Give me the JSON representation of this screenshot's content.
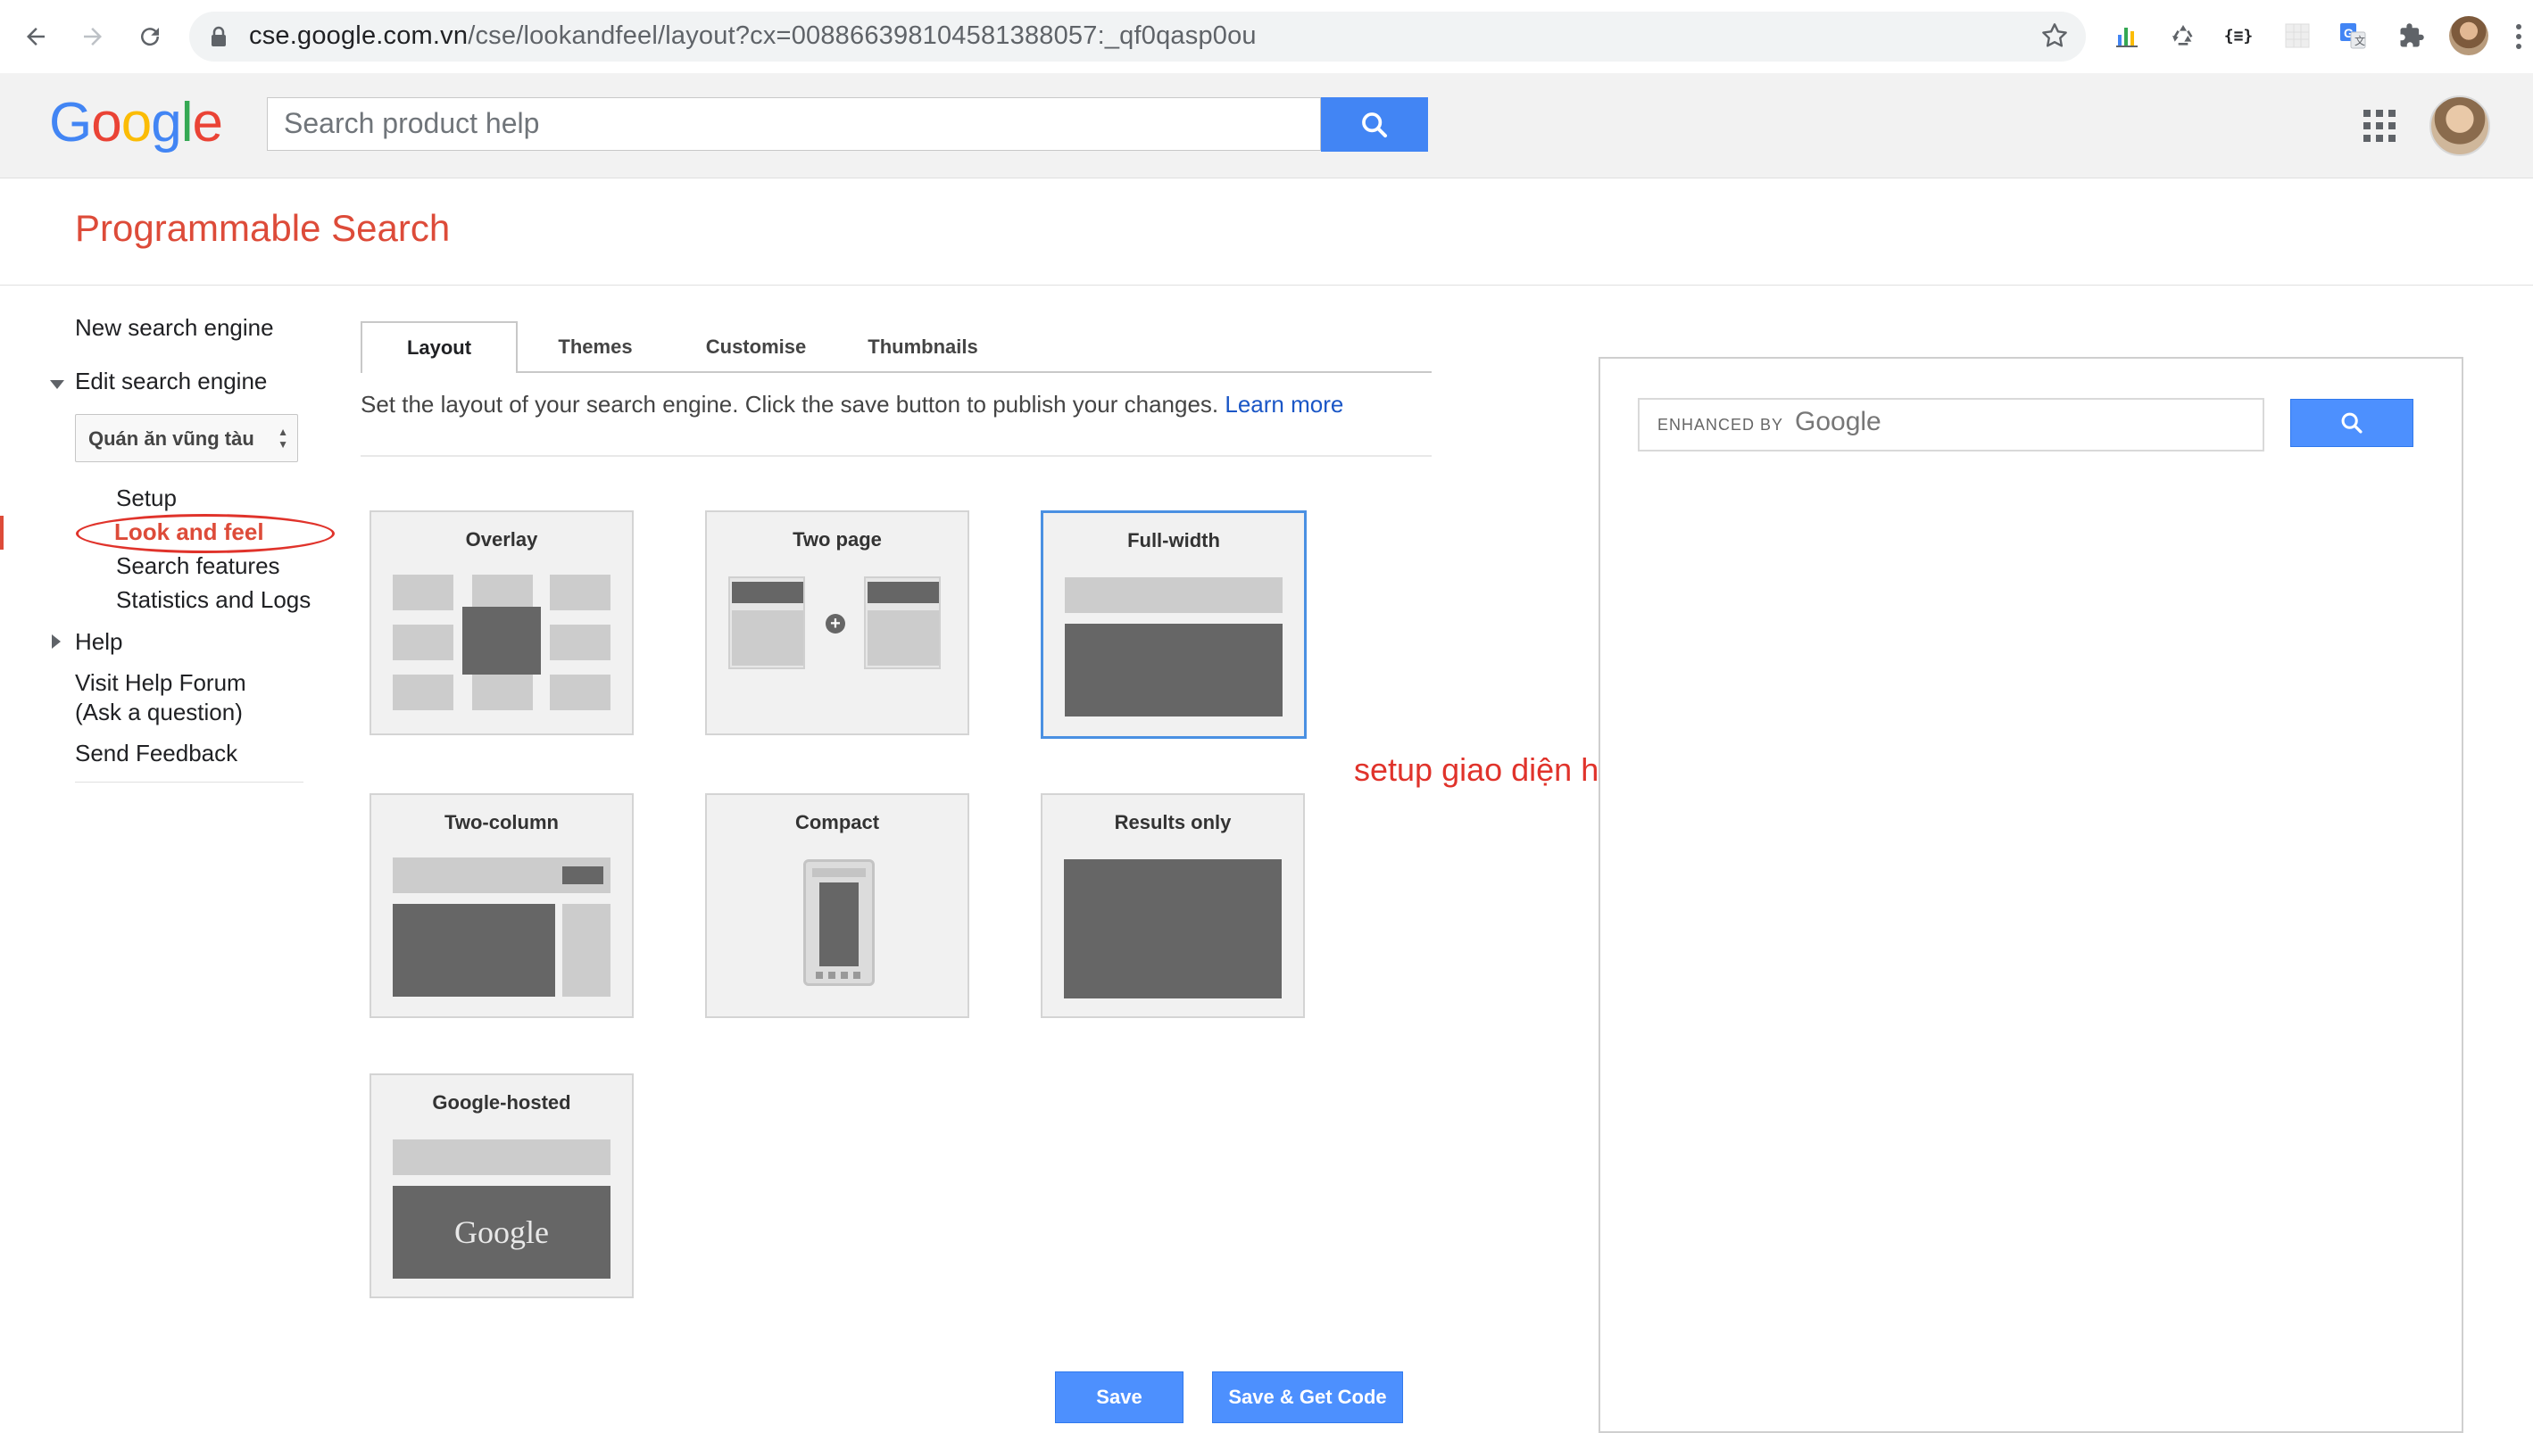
{
  "browser": {
    "url_host": "cse.google.com.vn",
    "url_path": "/cse/lookandfeel/layout?cx=008866398104581388057:_qf0qasp0ou",
    "extensions": [
      "bar-chart-icon",
      "recycle-icon",
      "braces-icon",
      "grid-square-icon",
      "translate-icon",
      "puzzle-icon"
    ]
  },
  "header": {
    "logo": [
      "G",
      "o",
      "o",
      "g",
      "l",
      "e"
    ],
    "logo_colors": [
      "#4285F4",
      "#EA4335",
      "#FBBC05",
      "#4285F4",
      "#34A853",
      "#EA4335"
    ],
    "search_placeholder": "Search product help"
  },
  "product_title": "Programmable Search",
  "sidebar": {
    "new_engine": "New search engine",
    "edit_engine": "Edit search engine",
    "engine_selected": "Quán ăn vũng tàu",
    "sub_items": [
      "Setup",
      "Look and feel",
      "Search features",
      "Statistics and Logs"
    ],
    "help": "Help",
    "forum_line1": "Visit Help Forum",
    "forum_line2": "(Ask a question)",
    "feedback": "Send Feedback"
  },
  "tabs": [
    "Layout",
    "Themes",
    "Customise",
    "Thumbnails"
  ],
  "description": {
    "text": "Set the layout of your search engine. Click the save button to publish your changes.",
    "link": "Learn more"
  },
  "layouts": {
    "overlay": "Overlay",
    "two_page": "Two page",
    "full_width": "Full-width",
    "two_column": "Two-column",
    "compact": "Compact",
    "results_only": "Results only",
    "google_hosted": "Google-hosted",
    "google_hosted_logo": "Google",
    "selected": "Full-width"
  },
  "annotation": "setup giao diện hiện thị",
  "preview": {
    "enhanced_by": "ENHANCED BY",
    "brand": "Google"
  },
  "buttons": {
    "save": "Save",
    "save_get_code": "Save & Get Code"
  },
  "colors": {
    "accent_red": "#dd4b39",
    "button_blue": "#4d90fe",
    "link_blue": "#1a56c6"
  }
}
